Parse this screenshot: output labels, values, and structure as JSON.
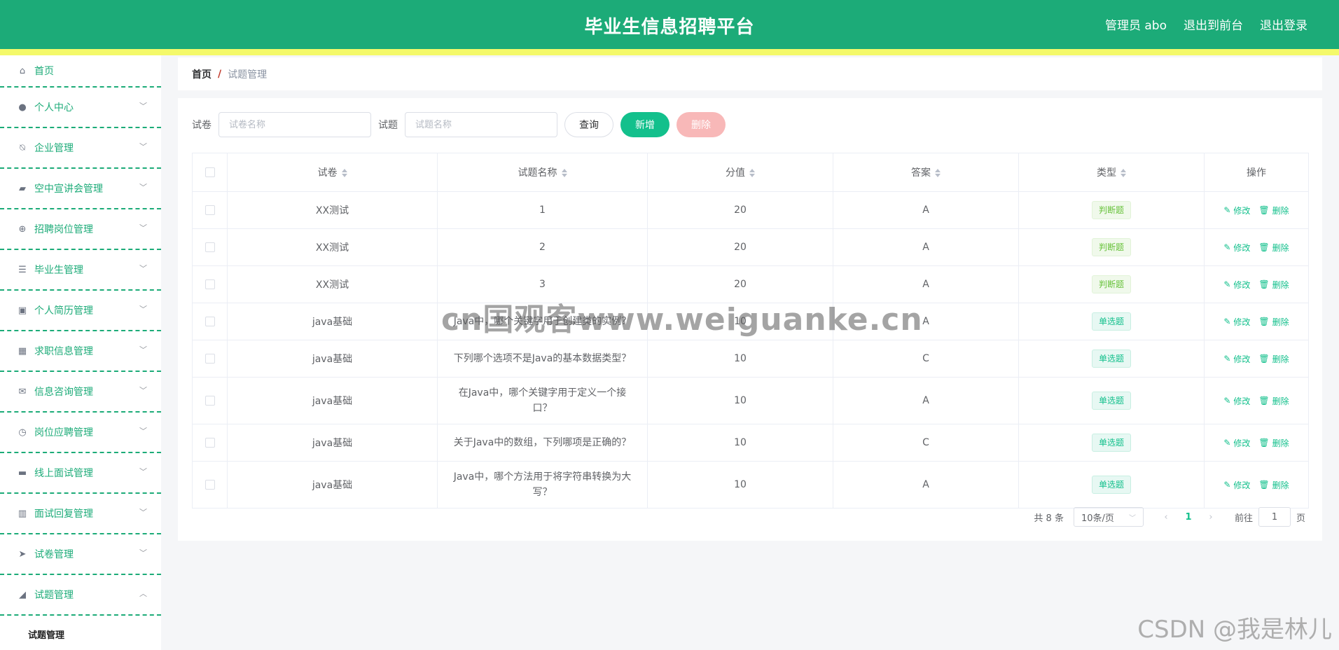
{
  "header": {
    "title": "毕业生信息招聘平台",
    "admin_label": "管理员 abo",
    "front_link": "退出到前台",
    "logout_link": "退出登录"
  },
  "sidebar": {
    "items": [
      {
        "label": "首页",
        "icon": "home-icon"
      },
      {
        "label": "个人中心",
        "icon": "user-icon"
      },
      {
        "label": "企业管理",
        "icon": "bell-off-icon"
      },
      {
        "label": "空中宣讲会管理",
        "icon": "suitcase-icon"
      },
      {
        "label": "招聘岗位管理",
        "icon": "target-icon"
      },
      {
        "label": "毕业生管理",
        "icon": "sliders-icon"
      },
      {
        "label": "个人简历管理",
        "icon": "clipboard-icon"
      },
      {
        "label": "求职信息管理",
        "icon": "grid-icon"
      },
      {
        "label": "信息咨询管理",
        "icon": "mail-icon"
      },
      {
        "label": "岗位应聘管理",
        "icon": "clock-icon"
      },
      {
        "label": "线上面试管理",
        "icon": "ticket-icon"
      },
      {
        "label": "面试回复管理",
        "icon": "books-icon"
      },
      {
        "label": "试卷管理",
        "icon": "send-icon"
      },
      {
        "label": "试题管理",
        "icon": "paper-plane-icon"
      }
    ],
    "sub_item": "试题管理"
  },
  "breadcrumb": {
    "home": "首页",
    "separator": "/",
    "current": "试题管理"
  },
  "search": {
    "paper_label": "试卷",
    "paper_placeholder": "试卷名称",
    "question_label": "试题",
    "question_placeholder": "试题名称",
    "query_button": "查询",
    "add_button": "新增",
    "delete_button": "删除"
  },
  "table": {
    "headers": [
      "试卷",
      "试题名称",
      "分值",
      "答案",
      "类型",
      "操作"
    ],
    "edit_label": "修改",
    "delete_label": "删除",
    "rows": [
      {
        "paper": "XX测试",
        "name": "1",
        "score": "20",
        "answer": "A",
        "type": "判断题"
      },
      {
        "paper": "XX测试",
        "name": "2",
        "score": "20",
        "answer": "A",
        "type": "判断题"
      },
      {
        "paper": "XX测试",
        "name": "3",
        "score": "20",
        "answer": "A",
        "type": "判断题"
      },
      {
        "paper": "java基础",
        "name": "Java中，哪个关键字用于创建类的实例？",
        "score": "10",
        "answer": "A",
        "type": "单选题"
      },
      {
        "paper": "java基础",
        "name": "下列哪个选项不是Java的基本数据类型？",
        "score": "10",
        "answer": "C",
        "type": "单选题"
      },
      {
        "paper": "java基础",
        "name": "在Java中，哪个关键字用于定义一个接口？",
        "score": "10",
        "answer": "A",
        "type": "单选题"
      },
      {
        "paper": "java基础",
        "name": "关于Java中的数组，下列哪项是正确的？",
        "score": "10",
        "answer": "C",
        "type": "单选题"
      },
      {
        "paper": "java基础",
        "name": "Java中，哪个方法用于将字符串转换为大写？",
        "score": "10",
        "answer": "A",
        "type": "单选题"
      }
    ]
  },
  "pagination": {
    "total": "共 8 条",
    "page_size": "10条/页",
    "current_page": "1",
    "goto_label": "前往",
    "goto_value": "1",
    "page_suffix": "页"
  },
  "watermarks": {
    "center": "cn国观客www.weiguanke.cn",
    "corner": "CSDN @我是林儿"
  },
  "colors": {
    "primary": "#1cab78",
    "accent_stripe": "#f4f96a",
    "button_add": "#13c08c",
    "button_delete": "#f8b8b8"
  }
}
